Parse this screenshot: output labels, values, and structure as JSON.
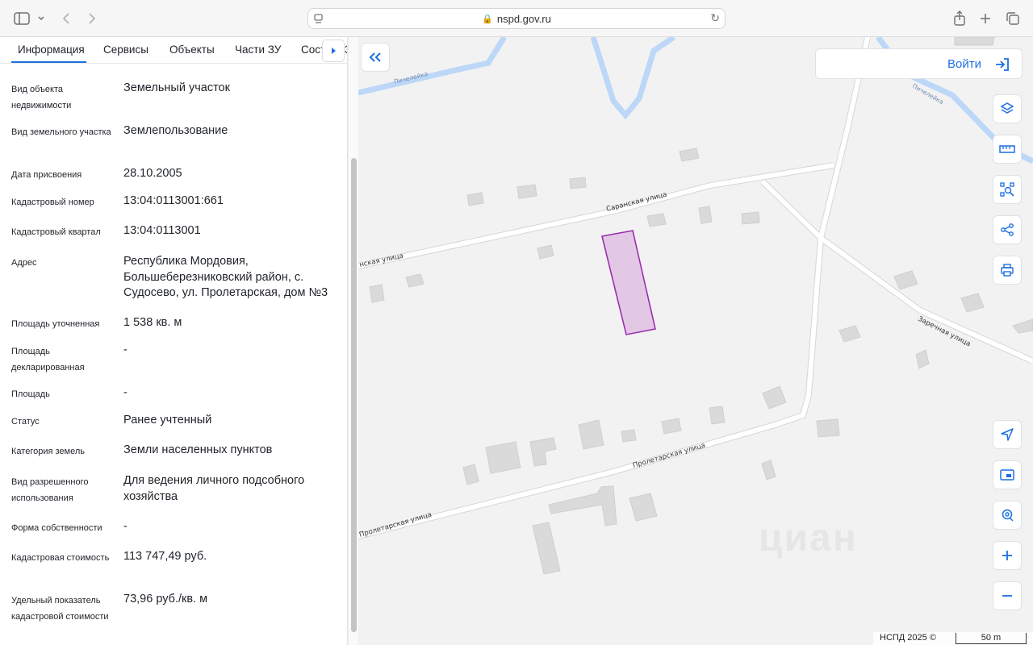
{
  "browser": {
    "url": "nspd.gov.ru"
  },
  "tabs": [
    "Информация",
    "Сервисы",
    "Объекты",
    "Части ЗУ",
    "Сост"
  ],
  "tab_overflow": "3",
  "info_rows": [
    {
      "label": "Вид объекта недвижимости",
      "value": "Земельный участок"
    },
    {
      "label": "Вид земельного участка",
      "value": "Землепользование"
    },
    {
      "label": "Дата присвоения",
      "value": "28.10.2005"
    },
    {
      "label": "Кадастровый номер",
      "value": "13:04:0113001:661"
    },
    {
      "label": "Кадастровый квартал",
      "value": "13:04:0113001"
    },
    {
      "label": "Адрес",
      "value": "Республика Мордовия, Большеберезниковский район, с. Судосево, ул. Пролетарская, дом №3"
    },
    {
      "label": "Площадь уточненная",
      "value": "1 538 кв. м"
    },
    {
      "label": "Площадь декларированная",
      "value": "-"
    },
    {
      "label": "Площадь",
      "value": "-"
    },
    {
      "label": "Статус",
      "value": "Ранее учтенный"
    },
    {
      "label": "Категория земель",
      "value": "Земли населенных пунктов"
    },
    {
      "label": "Вид разрешенного использования",
      "value": "Для ведения личного подсобного хозяйства"
    },
    {
      "label": "Форма собственности",
      "value": "-"
    },
    {
      "label": "Кадастровая стоимость",
      "value": "113 747,49 руб."
    },
    {
      "label": "Удельный показатель кадастровой стоимости",
      "value": "73,96 руб./кв. м"
    }
  ],
  "map": {
    "login_label": "Войти",
    "street_labels": [
      "Саранская улица",
      "нская улица",
      "Заречная улица",
      "Пролетарская улица",
      "Пролетарская улица",
      "Пичелейка",
      "Пичелейка"
    ],
    "attribution": "НСПД 2025 ©",
    "scale_label": "50 m",
    "watermark": "циан",
    "accent_color": "#1c6fe0",
    "parcel_fill": "#e3c8e6",
    "parcel_stroke": "#9b2fae",
    "water_color": "#bcd7f7"
  },
  "icons": {
    "tools": [
      "layers-icon",
      "ruler-icon",
      "search-area-icon",
      "share-icon",
      "print-icon"
    ],
    "controls": [
      "locate-icon",
      "minimap-icon",
      "geo-pin-icon",
      "zoom-in-icon",
      "zoom-out-icon"
    ]
  }
}
